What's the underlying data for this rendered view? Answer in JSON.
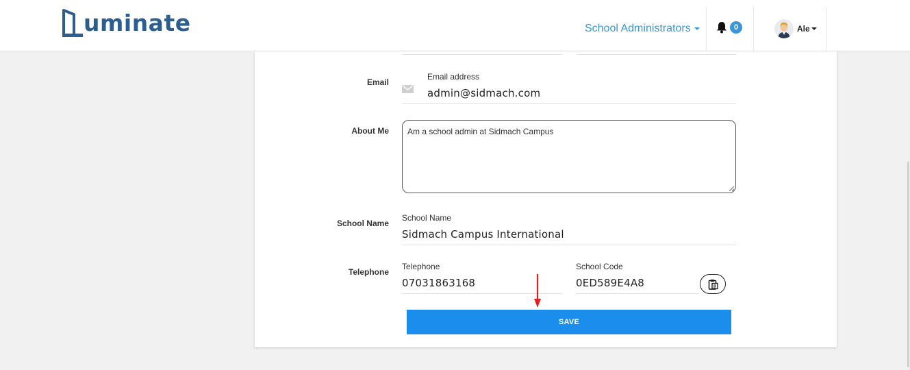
{
  "header": {
    "logo_text": "uminate",
    "role_menu_label": "School Administrators",
    "notification_count": "0",
    "user_name": "Ale"
  },
  "form": {
    "email": {
      "row_label": "Email",
      "field_label": "Email address",
      "value": "admin@sidmach.com"
    },
    "about": {
      "row_label": "About Me",
      "value": "Am a school admin at Sidmach Campus"
    },
    "school": {
      "row_label": "School Name",
      "field_label": "School Name",
      "value": "Sidmach Campus International"
    },
    "telephone": {
      "row_label": "Telephone",
      "field_label": "Telephone",
      "value": "07031863168"
    },
    "school_code": {
      "field_label": "School Code",
      "value": "0ED589E4A8"
    },
    "save_label": "SAVE"
  },
  "colors": {
    "brand": "#2c5f8f",
    "accent": "#3a96d8",
    "save_button": "#1a8ded",
    "annotation_arrow": "#e02020"
  },
  "icons": {
    "logo": "luminate-logo-icon",
    "notifications": "bell-icon",
    "email": "envelope-icon",
    "copy": "clipboard-copy-icon",
    "annotation": "red-arrow-icon"
  }
}
